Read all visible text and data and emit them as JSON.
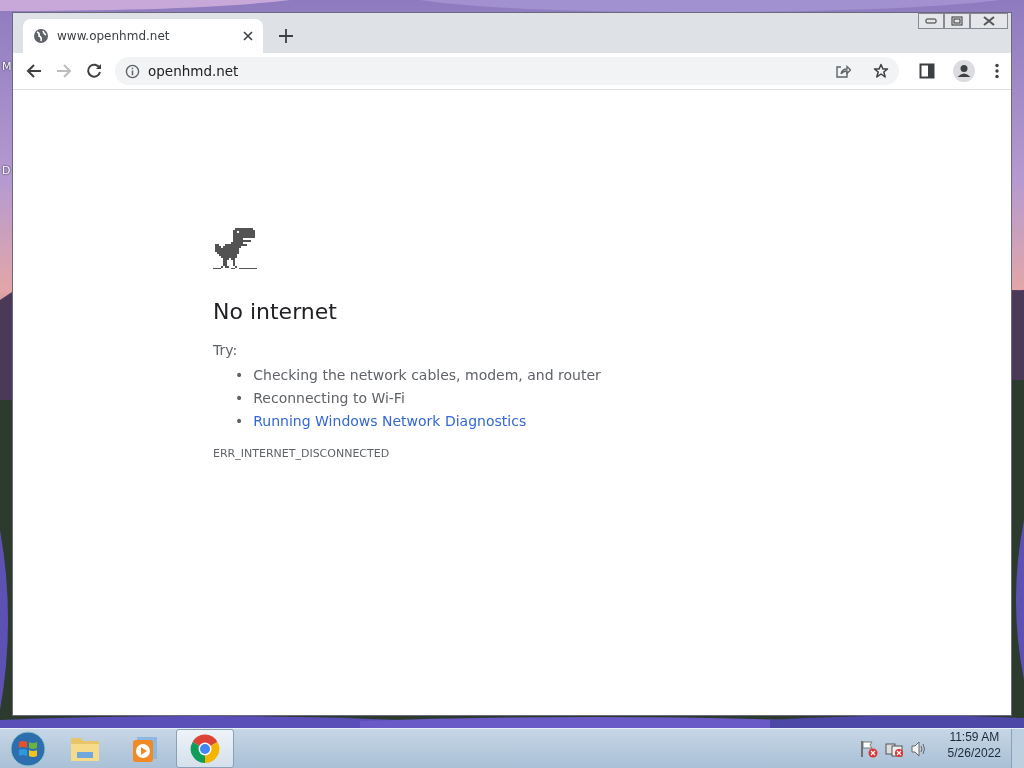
{
  "desktop": {
    "background": {
      "kind": "picture"
    },
    "icon_labels": [
      "M",
      "D"
    ]
  },
  "browser": {
    "tabs": [
      {
        "title": "www.openhmd.net",
        "selected": true
      }
    ],
    "toolbar": {
      "forward_disabled": true,
      "address": "openhmd.net"
    },
    "page": {
      "heading": "No internet",
      "try_label": "Try:",
      "suggestions": [
        {
          "bullet": "•",
          "text": "Checking the network cables, modem, and router",
          "kind": "text"
        },
        {
          "bullet": "•",
          "text": "Reconnecting to Wi-Fi",
          "kind": "text"
        },
        {
          "bullet": "•",
          "text": "Running Windows Network Diagnostics",
          "kind": "link"
        }
      ],
      "error_code": "ERR_INTERNET_DISCONNECTED"
    }
  },
  "taskbar": {
    "apps": [
      {
        "kind": "folder",
        "selected": false
      },
      {
        "kind": "media",
        "selected": false
      },
      {
        "kind": "browser",
        "selected": true
      }
    ],
    "clock": {
      "time": "11:59 AM",
      "date": "5/26/2022"
    }
  }
}
